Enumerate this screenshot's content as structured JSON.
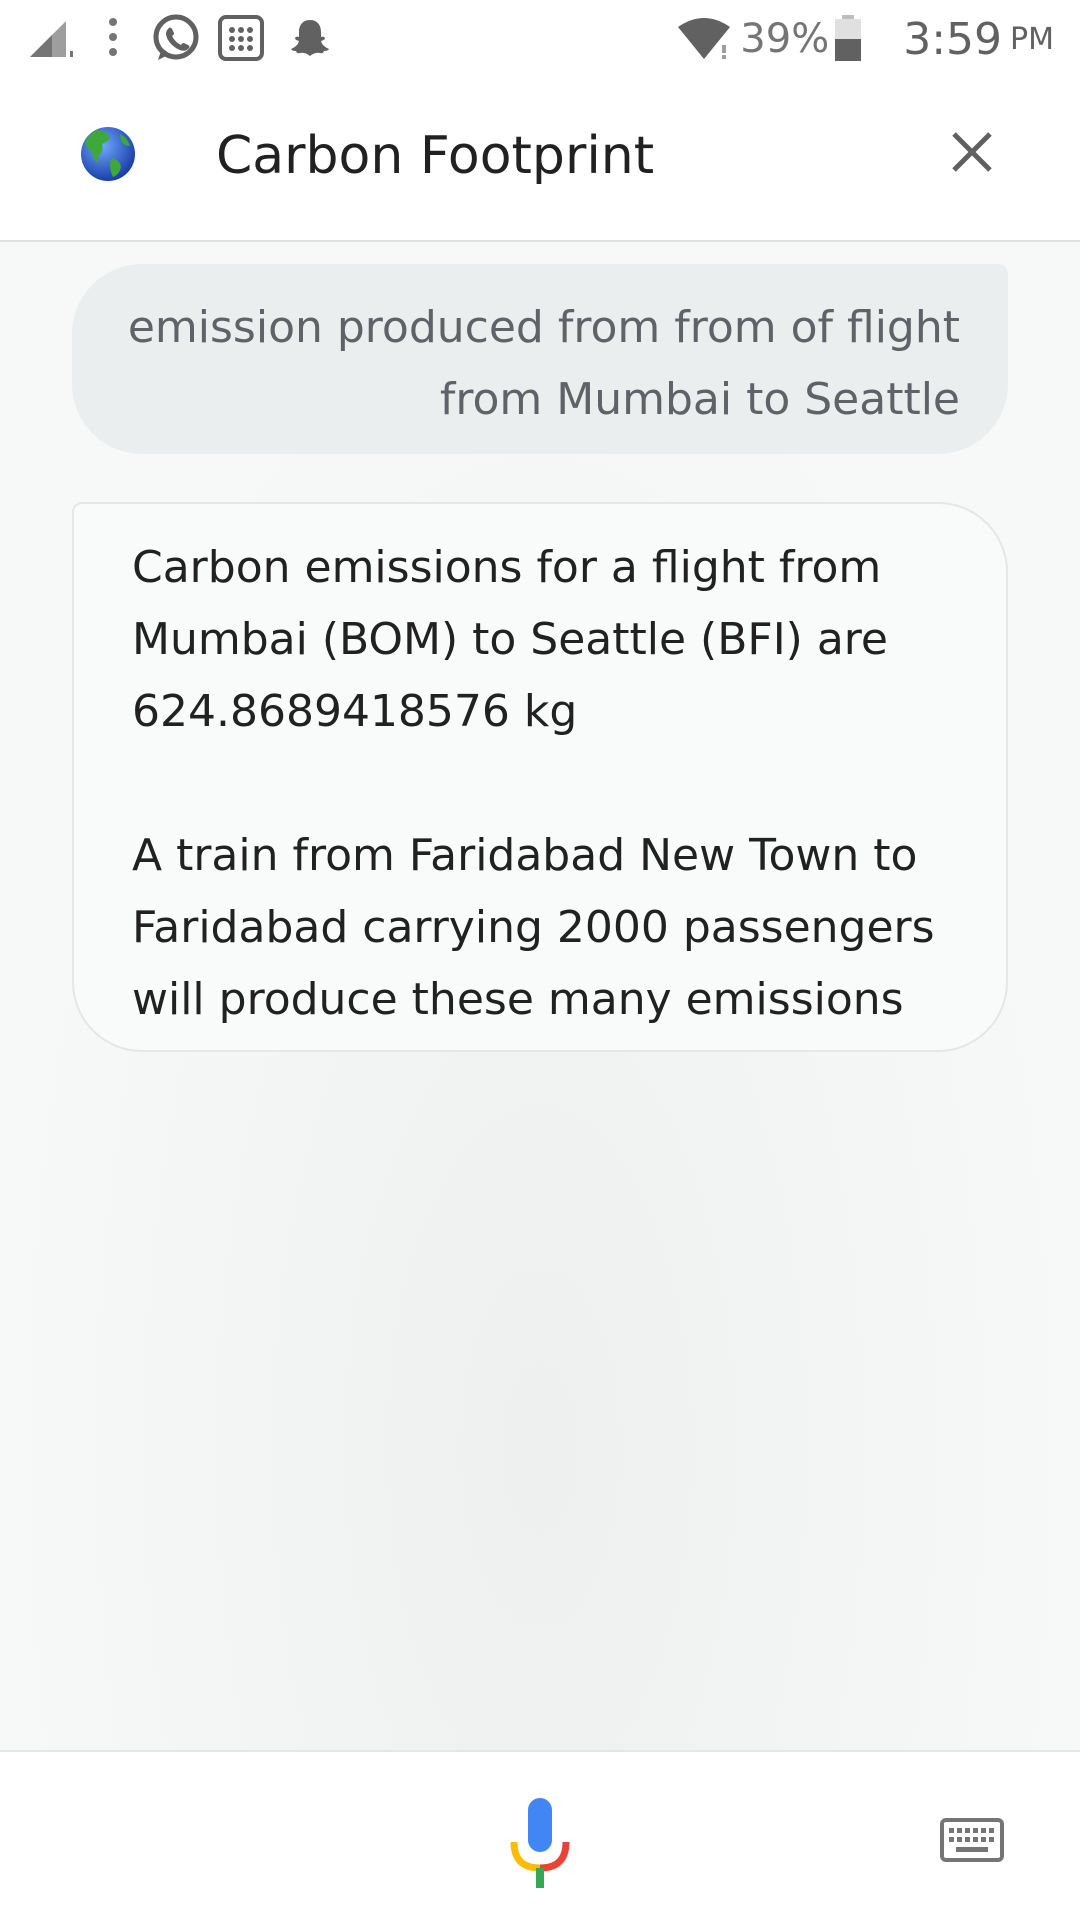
{
  "status_bar": {
    "battery_percent": "39%",
    "time": "3:59",
    "ampm": "PM",
    "icons": [
      "signal-icon",
      "more-vert-icon",
      "whatsapp-icon",
      "calculator-icon",
      "snapchat-icon",
      "wifi-icon",
      "battery-icon"
    ]
  },
  "header": {
    "title": "Carbon Footprint",
    "logo_icon": "globe-icon",
    "close_icon": "close-icon"
  },
  "conversation": {
    "user_message": "emission produced from from of flight from Mumbai to Seattle",
    "bot_paragraphs": [
      "Carbon emissions for a flight from Mumbai (BOM) to Seattle (BFI) are 624.8689418576 kg",
      "A train from Faridabad New Town to Faridabad carrying 2000 passengers will produce these many emissions"
    ]
  },
  "bottom_bar": {
    "mic_icon": "mic-icon",
    "keyboard_icon": "keyboard-icon"
  },
  "colors": {
    "google_blue": "#4285f4",
    "google_red": "#ea4335",
    "google_yellow": "#fbbc05",
    "google_green": "#34a853"
  }
}
